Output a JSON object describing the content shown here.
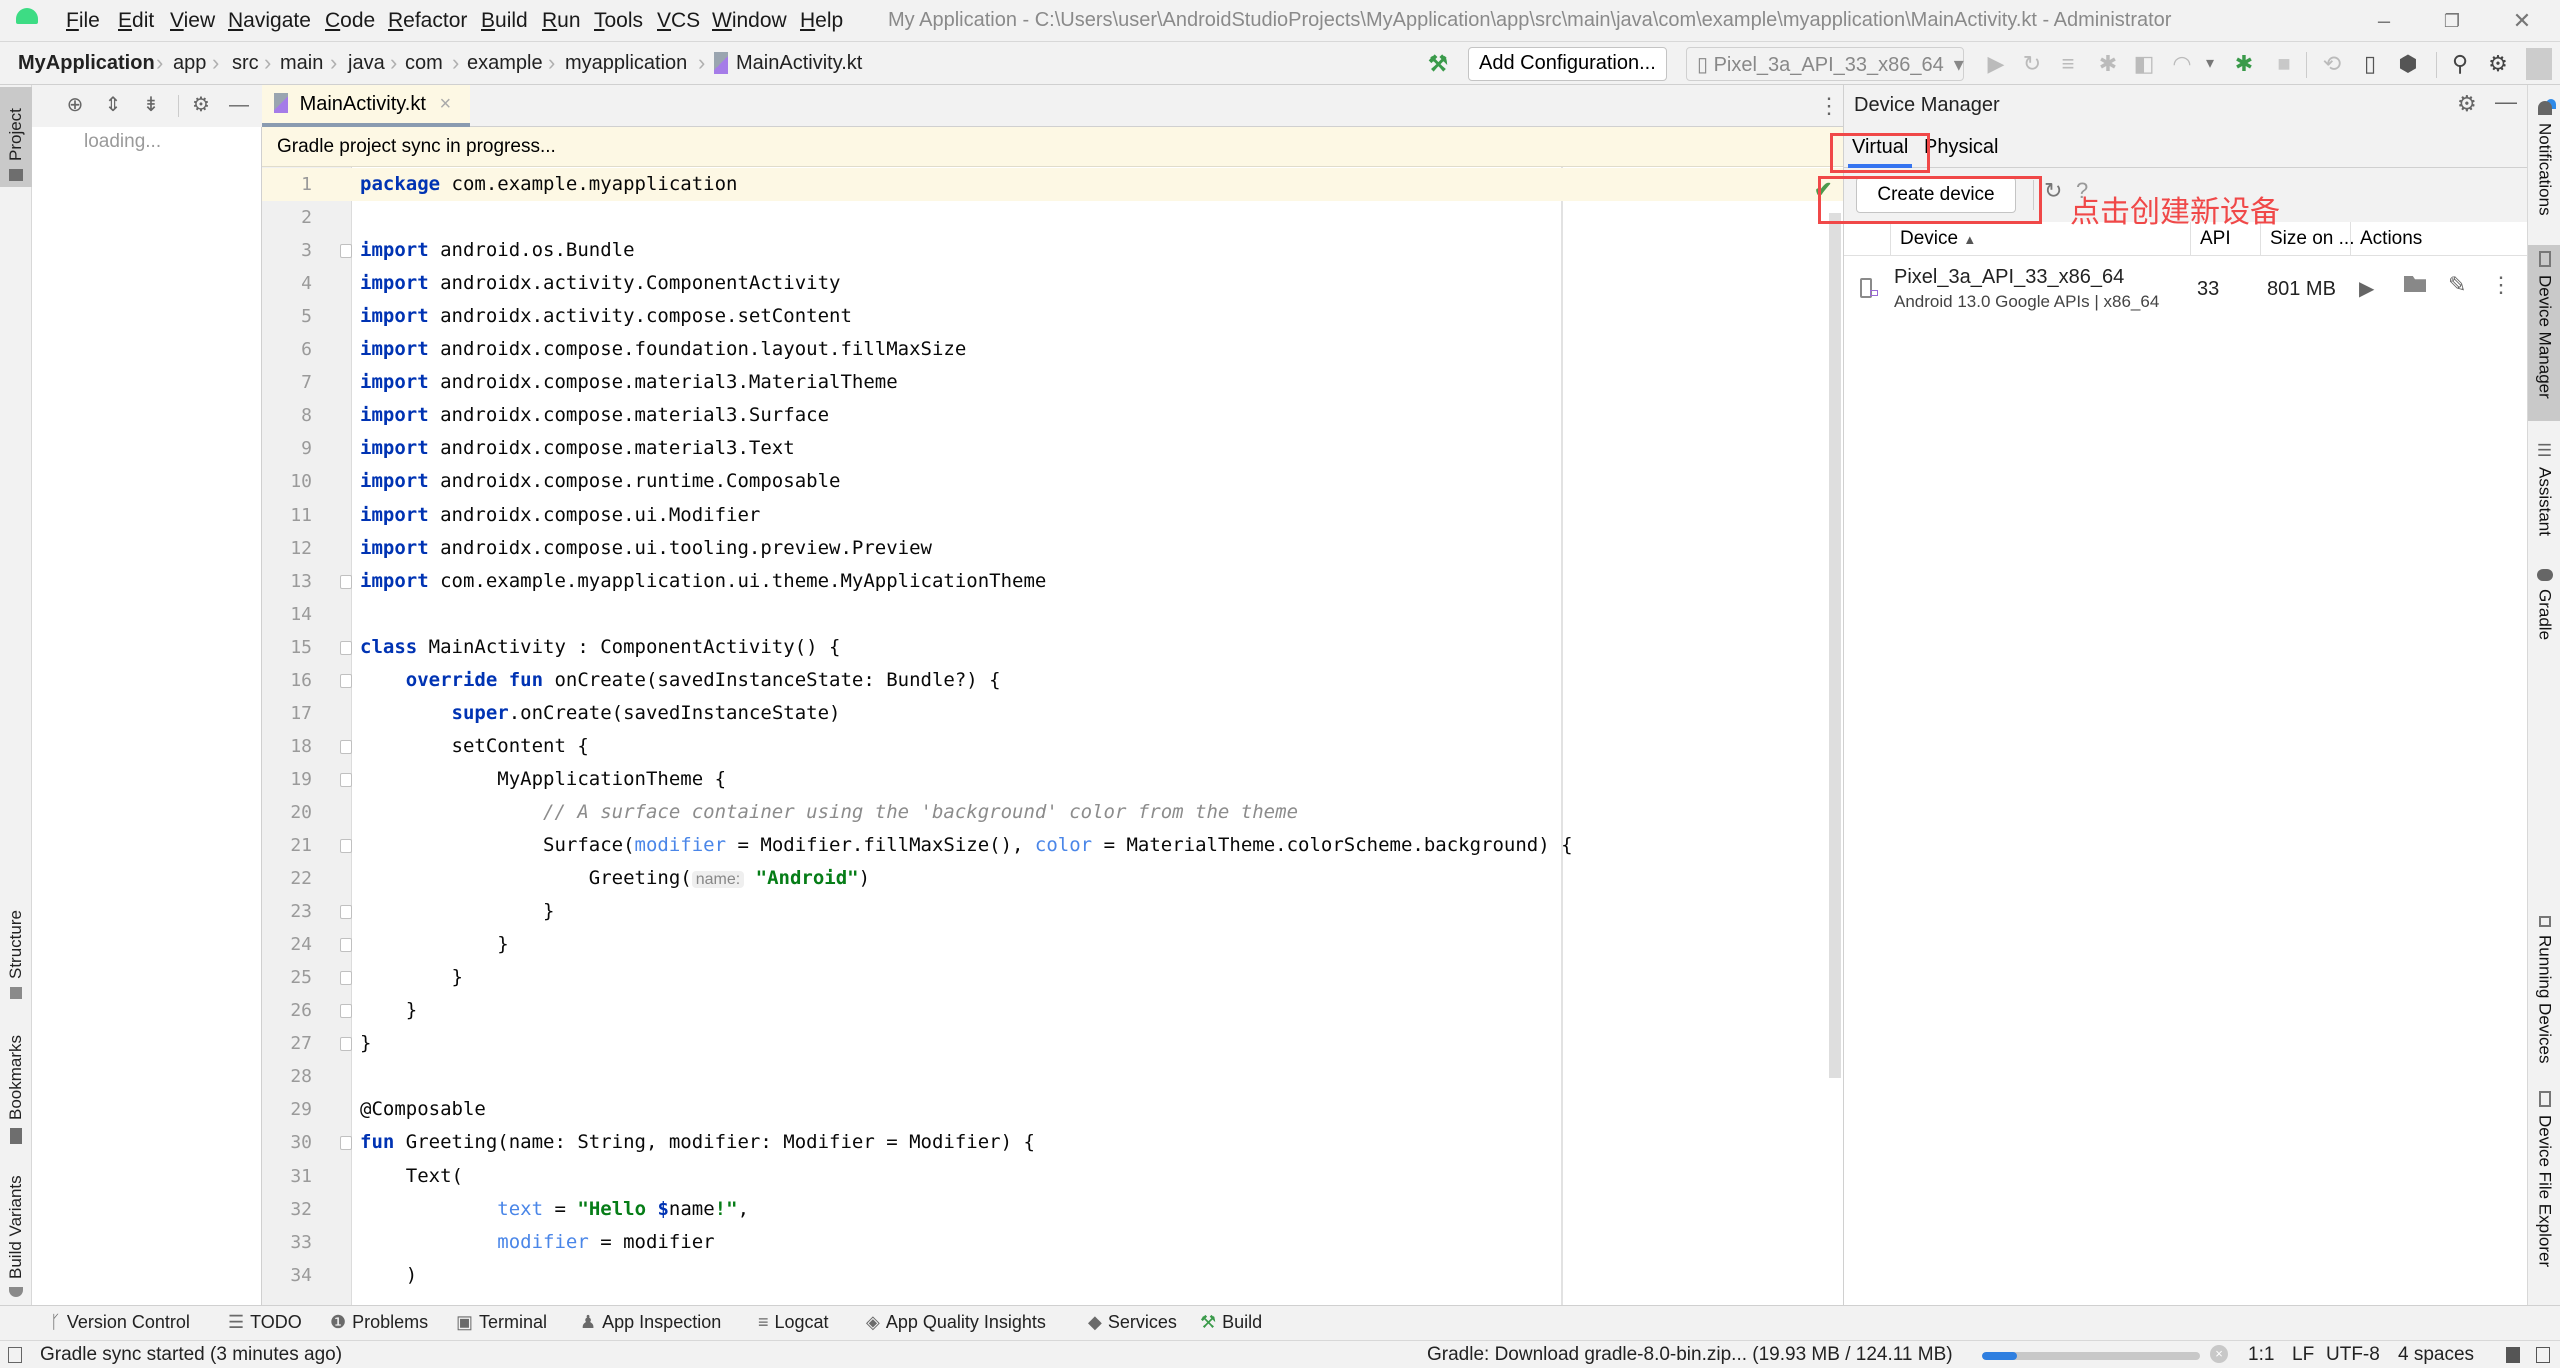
{
  "window": {
    "title": "My Application - C:\\Users\\user\\AndroidStudioProjects\\MyApplication\\app\\src\\main\\java\\com\\example\\myapplication\\MainActivity.kt - Administrator",
    "minimize": "–",
    "maximize": "❐",
    "close": "✕"
  },
  "menu": [
    "File",
    "Edit",
    "View",
    "Navigate",
    "Code",
    "Refactor",
    "Build",
    "Run",
    "Tools",
    "VCS",
    "Window",
    "Help"
  ],
  "breadcrumb": [
    "MyApplication",
    "app",
    "src",
    "main",
    "java",
    "com",
    "example",
    "myapplication",
    "MainActivity.kt"
  ],
  "toolbar": {
    "add_configuration": "Add Configuration...",
    "device_selector": "Pixel_3a_API_33_x86_64"
  },
  "left_strip": {
    "tabs": [
      "Project",
      "Structure",
      "Bookmarks",
      "Build Variants"
    ]
  },
  "project_panel": {
    "loading_text": "loading..."
  },
  "editor": {
    "tab_label": "MainActivity.kt",
    "banner": "Gradle project sync in progress...",
    "lines": [
      {
        "n": "1"
      },
      {
        "n": "2"
      },
      {
        "n": "3"
      },
      {
        "n": "4"
      },
      {
        "n": "5"
      },
      {
        "n": "6"
      },
      {
        "n": "7"
      },
      {
        "n": "8"
      },
      {
        "n": "9"
      },
      {
        "n": "10"
      },
      {
        "n": "11"
      },
      {
        "n": "12"
      },
      {
        "n": "13"
      },
      {
        "n": "14"
      },
      {
        "n": "15"
      },
      {
        "n": "16"
      },
      {
        "n": "17"
      },
      {
        "n": "18"
      },
      {
        "n": "19"
      },
      {
        "n": "20"
      },
      {
        "n": "21"
      },
      {
        "n": "22"
      },
      {
        "n": "23"
      },
      {
        "n": "24"
      },
      {
        "n": "25"
      },
      {
        "n": "26"
      },
      {
        "n": "27"
      },
      {
        "n": "28"
      },
      {
        "n": "29"
      },
      {
        "n": "30"
      },
      {
        "n": "31"
      },
      {
        "n": "32"
      },
      {
        "n": "33"
      },
      {
        "n": "34"
      }
    ],
    "code": {
      "l1_kw": "package",
      "l1_rest": " com.example.myapplication",
      "imp": "import",
      "l3": " android.os.Bundle",
      "l4": " androidx.activity.ComponentActivity",
      "l5": " androidx.activity.compose.setContent",
      "l6": " androidx.compose.foundation.layout.fillMaxSize",
      "l7": " androidx.compose.material3.MaterialTheme",
      "l8": " androidx.compose.material3.Surface",
      "l9": " androidx.compose.material3.Text",
      "l10": " androidx.compose.runtime.Composable",
      "l11": " androidx.compose.ui.Modifier",
      "l12": " androidx.compose.ui.tooling.preview.Preview",
      "l13": " com.example.myapplication.ui.theme.MyApplicationTheme",
      "l15_kw": "class",
      "l15_rest": " MainActivity : ComponentActivity() {",
      "l16_kw": "override fun",
      "l16_rest": " onCreate(savedInstanceState: Bundle?) {",
      "l17_kw": "super",
      "l17_rest": ".onCreate(savedInstanceState)",
      "l18": "setContent {",
      "l19": "MyApplicationTheme {",
      "l20": "// A surface container using the 'background' color from the theme",
      "l21_a": "Surface(",
      "l21_p1": "modifier",
      "l21_b": " = Modifier.fillMaxSize(), ",
      "l21_p2": "color",
      "l21_c": " = MaterialTheme.colorScheme.background) {",
      "l22_a": "Greeting(",
      "l22_hint": "name:",
      "l22_str": "\"Android\"",
      "l22_b": ")",
      "l23": "}",
      "l24": "}",
      "l25": "}",
      "l26": "}",
      "l27": "}",
      "l29": "@Composable",
      "l30_kw": "fun",
      "l30_rest": " Greeting(name: String, modifier: Modifier = Modifier) {",
      "l31": "Text(",
      "l32_p": "text",
      "l32_eq": " = ",
      "l32_s1": "\"Hello ",
      "l32_dollar": "$",
      "l32_name": "name",
      "l32_s2": "!\"",
      "l32_end": ",",
      "l33_p": "modifier",
      "l33_rest": " = modifier",
      "l34": ")"
    }
  },
  "device_manager": {
    "title": "Device Manager",
    "tabs": [
      "Virtual",
      "Physical"
    ],
    "active_tab": "Virtual",
    "create_button": "Create device",
    "columns": [
      "Device",
      "API",
      "Size on ...",
      "Actions"
    ],
    "devices": [
      {
        "name": "Pixel_3a_API_33_x86_64",
        "subtitle": "Android 13.0 Google APIs | x86_64",
        "api": "33",
        "size": "801 MB"
      }
    ]
  },
  "annotation": {
    "text": "点击创建新设备",
    "color": "#f04848"
  },
  "right_strip": {
    "tabs": [
      "Notifications",
      "Device Manager",
      "Assistant",
      "Gradle",
      "Running Devices",
      "Device File Explorer"
    ]
  },
  "tool_windows": [
    "Version Control",
    "TODO",
    "Problems",
    "Terminal",
    "App Inspection",
    "Logcat",
    "App Quality Insights",
    "Services",
    "Build"
  ],
  "status": {
    "message": "Gradle sync started (3 minutes ago)",
    "download": "Gradle: Download gradle-8.0-bin.zip... (19.93 MB / 124.11 MB)",
    "download_progress": 0.16,
    "position": "1:1",
    "line_sep": "LF",
    "encoding": "UTF-8",
    "indent": "4 spaces"
  },
  "colors": {
    "accent": "#3574f0",
    "keyword": "#0033b3",
    "string": "#067d17",
    "param": "#4a86e8",
    "banner_bg": "#fdf8e4"
  }
}
